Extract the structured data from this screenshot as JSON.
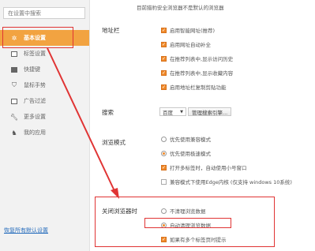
{
  "sidebar": {
    "search_placeholder": "在设置中搜索",
    "items": [
      {
        "label": "基本设置",
        "icon": "gear-icon",
        "active": true
      },
      {
        "label": "标签设置",
        "icon": "tab-icon",
        "active": false
      },
      {
        "label": "快捷键",
        "icon": "keyboard-icon",
        "active": false
      },
      {
        "label": "鼠标手势",
        "icon": "mouse-icon",
        "active": false
      },
      {
        "label": "广告过滤",
        "icon": "filter-icon",
        "active": false
      },
      {
        "label": "更多设置",
        "icon": "wrench-icon",
        "active": false
      },
      {
        "label": "我的应用",
        "icon": "apps-icon",
        "active": false
      }
    ],
    "restore_label": "恢复所有默认设置"
  },
  "top_note": "目前猎豹安全浏览器不是默认的浏览器",
  "address_bar": {
    "label": "地址栏",
    "options": [
      {
        "label": "启用智能网址(推荐)",
        "checked": true
      },
      {
        "label": "启用网址自动补全",
        "checked": true
      },
      {
        "label": "在推荐列表中,显示访问历史",
        "checked": true
      },
      {
        "label": "在推荐列表中,显示收藏内容",
        "checked": true
      },
      {
        "label": "启用地址栏复制剪贴功能",
        "checked": true
      }
    ]
  },
  "search": {
    "label": "搜索",
    "engine": "百度",
    "manage_button": "管理搜索引擎..."
  },
  "browse_mode": {
    "label": "浏览模式",
    "radios": [
      {
        "label": "优先使用兼容模式",
        "selected": false
      },
      {
        "label": "优先使用极速模式",
        "selected": true
      }
    ],
    "options": [
      {
        "label": "打开多标签时，自动使用小号窗口",
        "checked": true
      },
      {
        "label": "兼容模式下使用Edge内核 (仅支持 windows 10系统)",
        "checked": false
      }
    ]
  },
  "on_close": {
    "label": "关闭浏览器时",
    "radios": [
      {
        "label": "不清理浏览数据",
        "selected": false
      },
      {
        "label": "自动清理浏览数据",
        "selected": true
      }
    ],
    "options": [
      {
        "label": "如果有多个标签页时提示",
        "checked": true
      }
    ]
  },
  "colors": {
    "active_nav": "#f2a341",
    "checkbox": "#f08a2a",
    "highlight_box": "#e03434",
    "link": "#2a6fbd"
  }
}
